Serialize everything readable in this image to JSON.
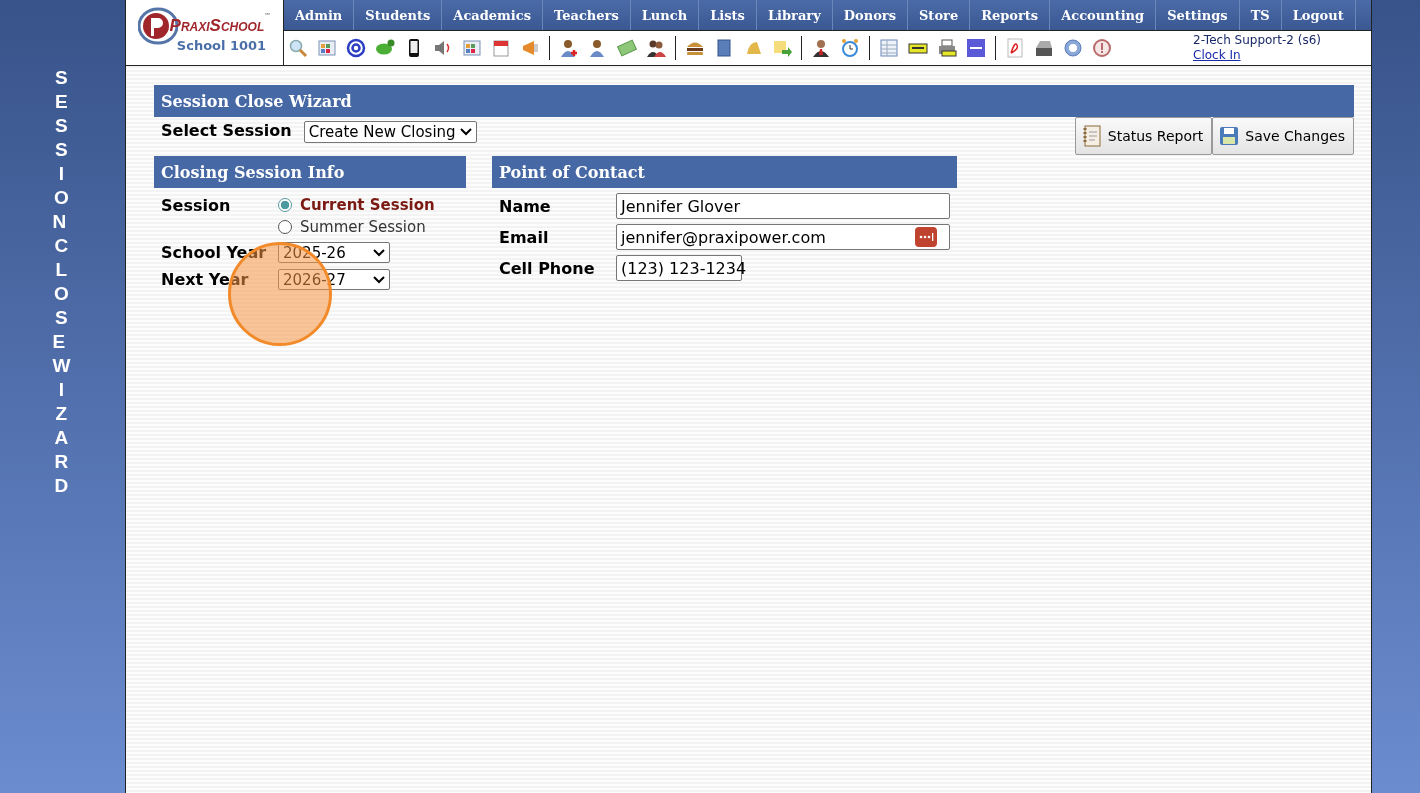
{
  "logo": {
    "name": "PraxiSchool",
    "mark": "℠",
    "school": "School 1001"
  },
  "nav": [
    "Admin",
    "Students",
    "Academics",
    "Teachers",
    "Lunch",
    "Lists",
    "Library",
    "Donors",
    "Store",
    "Reports",
    "Accounting",
    "Settings",
    "TS",
    "Logout"
  ],
  "user": {
    "name": "2-Tech Support-2 (s6)",
    "link": "Clock In"
  },
  "side_title": "SESSION CLOSE WIZARD",
  "wizard": {
    "title": "Session Close Wizard",
    "select_label": "Select Session",
    "select_value": "Create New Closing",
    "buttons": [
      {
        "label": "Status Report",
        "kind": "report"
      },
      {
        "label": "Save Changes",
        "kind": "save"
      }
    ]
  },
  "closing_info": {
    "title": "Closing Session Info",
    "session_label": "Session",
    "sessions": [
      {
        "label": "Current Session",
        "selected": true
      },
      {
        "label": "Summer Session",
        "selected": false
      }
    ],
    "fields": [
      {
        "label": "School Year",
        "value": "2025-26"
      },
      {
        "label": "Next Year",
        "value": "2026-27"
      }
    ]
  },
  "contact": {
    "title": "Point of Contact",
    "fields": [
      {
        "label": "Name",
        "value": "Jennifer Glover",
        "kind": "text"
      },
      {
        "label": "Email",
        "value": "jennifer@praxipower.com",
        "kind": "email"
      },
      {
        "label": "Cell Phone",
        "value": "(123) 123-1234",
        "kind": "phone"
      }
    ]
  },
  "click_highlight": true
}
